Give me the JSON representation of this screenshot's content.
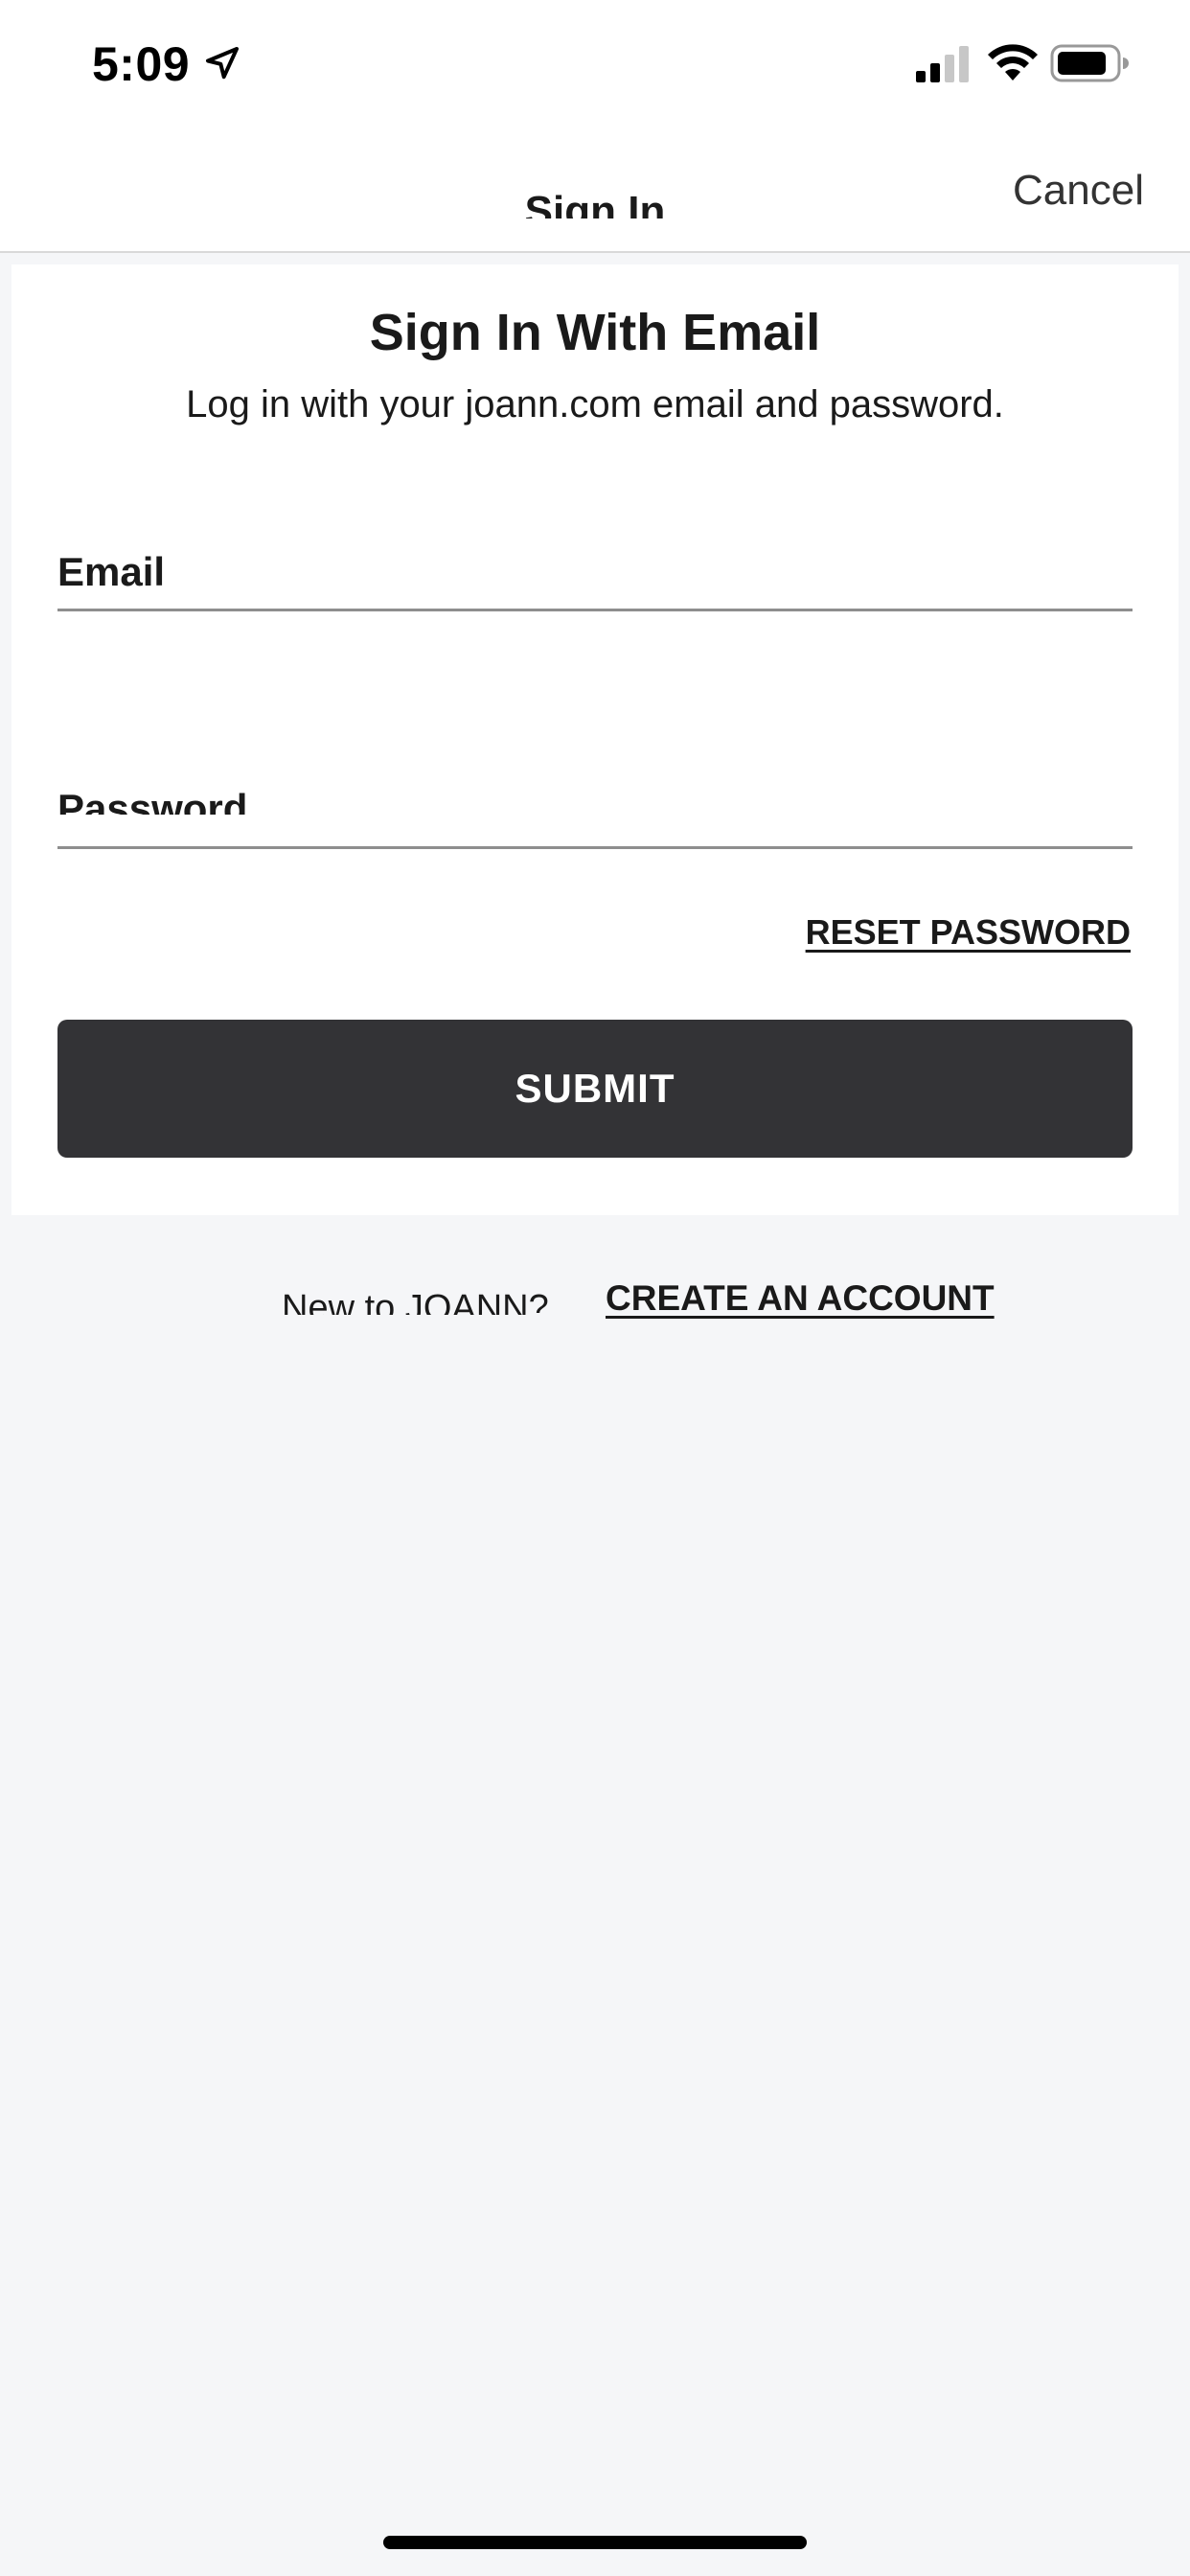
{
  "status_bar": {
    "time": "5:09",
    "icons": [
      "location-arrow-icon",
      "signal-icon",
      "wifi-icon",
      "battery-icon"
    ]
  },
  "nav": {
    "title": "Sign In",
    "cancel_label": "Cancel"
  },
  "card": {
    "title": "Sign In With Email",
    "subtitle": "Log in with your joann.com email and password.",
    "email_label": "Email",
    "password_label": "Password",
    "reset_label": "RESET PASSWORD",
    "submit_label": "SUBMIT"
  },
  "footer": {
    "new_to_text": "New to JOANN?",
    "create_account_label": "CREATE AN ACCOUNT"
  },
  "colors": {
    "submit_bg": "#333336",
    "page_bg": "#f5f6f8",
    "card_bg": "#ffffff"
  }
}
